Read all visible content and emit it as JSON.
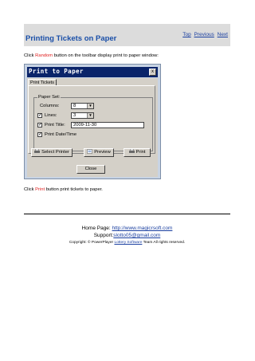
{
  "header": {
    "title": "Printing Tickets on Paper",
    "nav": {
      "top": "Top",
      "previous": "Previous",
      "next": "Next"
    }
  },
  "intro": {
    "pre": "Click ",
    "highlight": "Random",
    "post": " button on the toolbar display print to paper window:"
  },
  "dialog": {
    "title": "Print to Paper",
    "close_glyph": "x",
    "tab": "Print Tickets",
    "group_label": "Paper Set:",
    "columns_label": "Columns:",
    "columns_value": "8",
    "lines_label": "Lines:",
    "lines_value": "3",
    "lines_checked": true,
    "print_title_label": "Print Title:",
    "print_title_value": "2009-11-30",
    "print_title_checked": true,
    "print_datetime_label": "Print Date/Time",
    "print_datetime_checked": true,
    "buttons": {
      "select_printer": "Select Printer",
      "preview": "Preview",
      "print": "Print",
      "close": "Close"
    }
  },
  "outro": {
    "pre": "Click ",
    "highlight": "Print",
    "post": " button print tickets to paper."
  },
  "footer": {
    "homepage_label": "Home Page: ",
    "homepage_url": "http://www.magicrsoft.com",
    "support_label": "Support:",
    "support_email": "slotto05@gmail.com",
    "copyright_pre": "Copyright: © PowerPlayer ",
    "copyright_link": "Lottery Software",
    "copyright_post": " Team All rights reserved."
  },
  "colors": {
    "title_blue": "#1a4fa8",
    "highlight_red": "#e02020",
    "link_blue": "#1a3fa0",
    "titlebar": "#0a246a"
  }
}
